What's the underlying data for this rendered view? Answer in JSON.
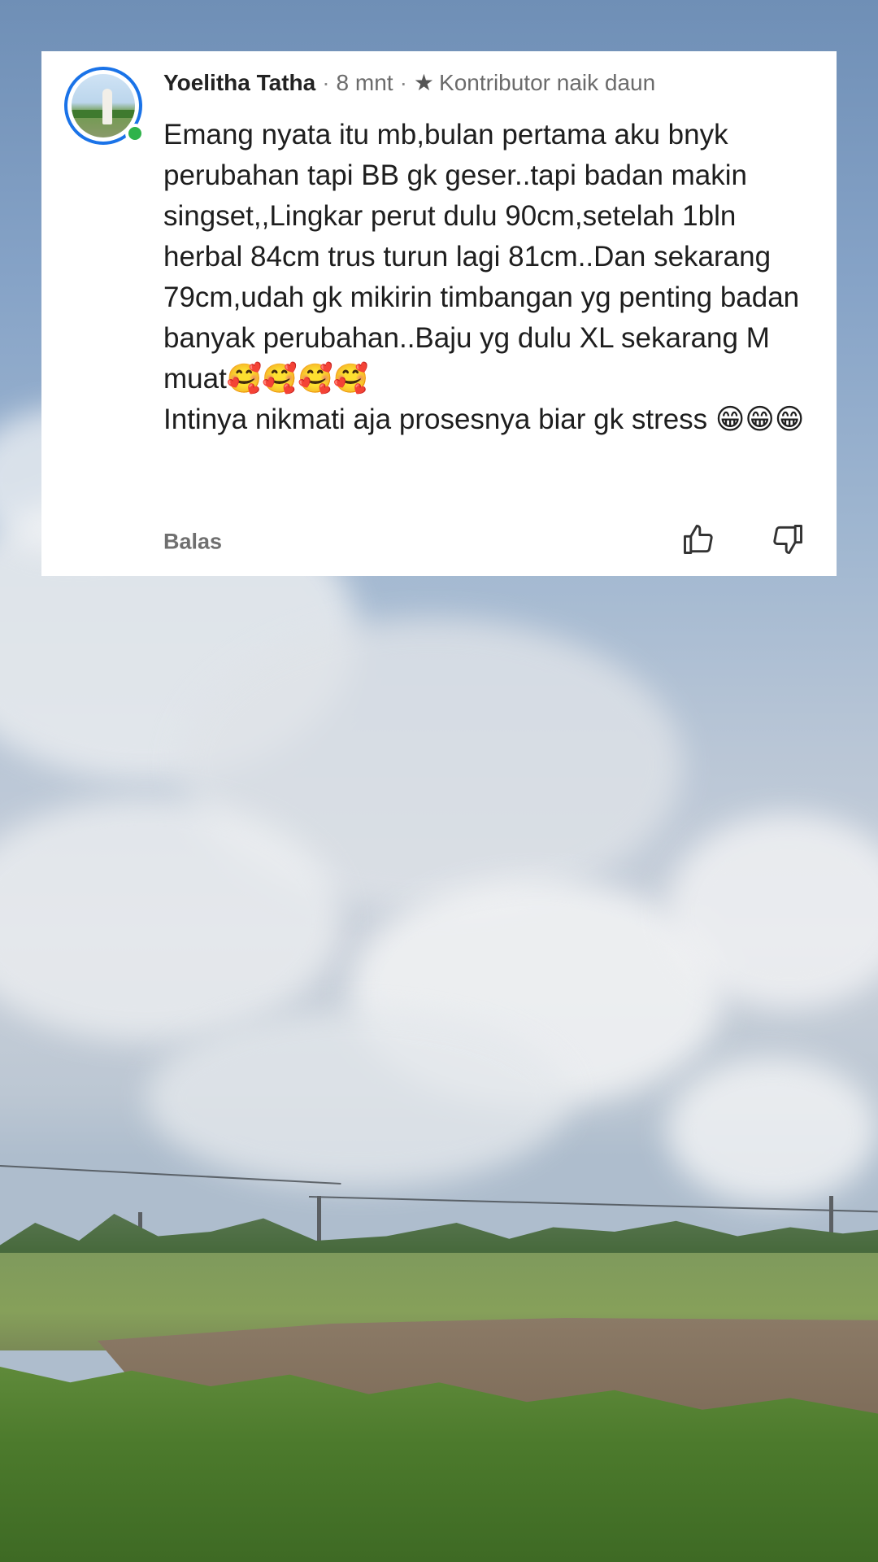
{
  "comment": {
    "author": "Yoelitha Tatha",
    "time": "8 mnt",
    "badge_label": "Kontributor naik daun",
    "badge_icon": "star-icon",
    "online": true,
    "text": "Emang nyata itu mb,bulan pertama aku bnyk perubahan tapi BB gk geser..tapi badan makin singset,,Lingkar perut dulu 90cm,setelah 1bln herbal 84cm trus turun lagi 81cm..Dan sekarang 79cm,udah gk mikirin timbangan yg penting badan banyak perubahan..Baju yg dulu XL sekarang M muat🥰🥰🥰🥰\nIntinya nikmati aja prosesnya biar gk stress 😁😁😁",
    "reply_label": "Balas",
    "actions": {
      "like_icon": "thumbs-up-icon",
      "dislike_icon": "thumbs-down-icon"
    }
  },
  "colors": {
    "accent": "#1a73e8",
    "online": "#2fb34a"
  }
}
